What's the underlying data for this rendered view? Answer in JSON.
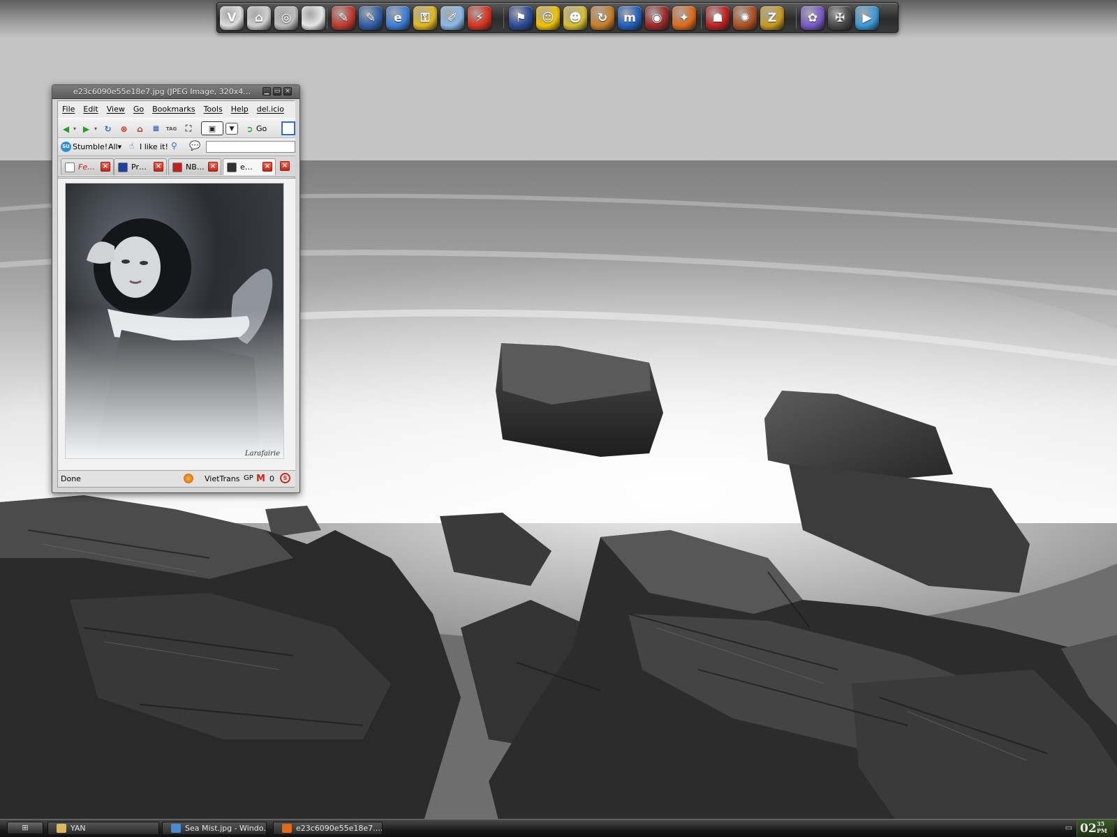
{
  "dock": {
    "icons": [
      {
        "name": "vlc-icon",
        "glyph": "V",
        "color": "#dddddd"
      },
      {
        "name": "home-icon",
        "glyph": "⌂",
        "color": "#cfcfcf"
      },
      {
        "name": "disc-icon",
        "glyph": "◎",
        "color": "#bdbdbd"
      },
      {
        "name": "apple-icon",
        "glyph": "",
        "color": "#e6e6e6"
      },
      {
        "name": "tool-red-icon",
        "glyph": "✎",
        "color": "#c0392b"
      },
      {
        "name": "tool-blue-icon",
        "glyph": "✎",
        "color": "#2e5da8"
      },
      {
        "name": "internet-explorer-icon",
        "glyph": "e",
        "color": "#3b7dd8"
      },
      {
        "name": "keys-icon",
        "glyph": "⚿",
        "color": "#e0b820"
      },
      {
        "name": "notepad-icon",
        "glyph": "✐",
        "color": "#8ab8e8"
      },
      {
        "name": "flashget-icon",
        "glyph": "⚡",
        "color": "#d8321e"
      },
      {
        "name": "msn-icon",
        "glyph": "⚑",
        "color": "#2c4a9a"
      },
      {
        "name": "smiley-icon",
        "glyph": "☺",
        "color": "#f2c200"
      },
      {
        "name": "messenger-icon",
        "glyph": "☻",
        "color": "#d8c030"
      },
      {
        "name": "refresh-orb-icon",
        "glyph": "↻",
        "color": "#c87e28"
      },
      {
        "name": "maxthon-icon",
        "glyph": "m",
        "color": "#2060c0"
      },
      {
        "name": "globe-icon",
        "glyph": "◉",
        "color": "#a02828"
      },
      {
        "name": "firefox-icon",
        "glyph": "✦",
        "color": "#e06a1a"
      },
      {
        "name": "ninja-icon",
        "glyph": "☗",
        "color": "#c02020"
      },
      {
        "name": "burst-icon",
        "glyph": "✺",
        "color": "#b05020"
      },
      {
        "name": "zune-icon",
        "glyph": "Z",
        "color": "#c89a20"
      },
      {
        "name": "paint-icon",
        "glyph": "✿",
        "color": "#7a5ac8"
      },
      {
        "name": "foobar-icon",
        "glyph": "✠",
        "color": "#4a4a4a"
      },
      {
        "name": "media-player-icon",
        "glyph": "▶",
        "color": "#3a9ad8"
      }
    ]
  },
  "browser": {
    "title": "e23c6090e55e18e7.jpg (JPEG Image, 320x4…",
    "menu": [
      "File",
      "Edit",
      "View",
      "Go",
      "Bookmarks",
      "Tools",
      "Help",
      "del.icio"
    ],
    "go_label": "Go",
    "stumble": {
      "stumble_label": "Stumble!",
      "all_label": "All▾",
      "like_label": "I like it!"
    },
    "tabs": [
      {
        "label": "Fe…",
        "italic_red": true,
        "fav_color": "#ffffff"
      },
      {
        "label": "Pr…",
        "italic_red": false,
        "fav_color": "#2040a0"
      },
      {
        "label": "NB…",
        "italic_red": false,
        "fav_color": "#c02020"
      },
      {
        "label": "e…",
        "italic_red": false,
        "fav_color": "#333333"
      }
    ],
    "photo_signature": "Larafairie",
    "status": {
      "text": "Done",
      "viettrans": "VietTrans",
      "gp": "GP",
      "gmail_count": "0"
    }
  },
  "taskbar": {
    "tasks": [
      {
        "label": "YAN",
        "icon_color": "#d8b860"
      },
      {
        "label": "Sea Mist.jpg - Windo…",
        "icon_color": "#4a8ad0"
      },
      {
        "label": "e23c6090e55e18e7.…",
        "icon_color": "#e06a1a"
      }
    ],
    "clock_hour": "02",
    "clock_min": "35",
    "clock_ampm": "PM"
  }
}
